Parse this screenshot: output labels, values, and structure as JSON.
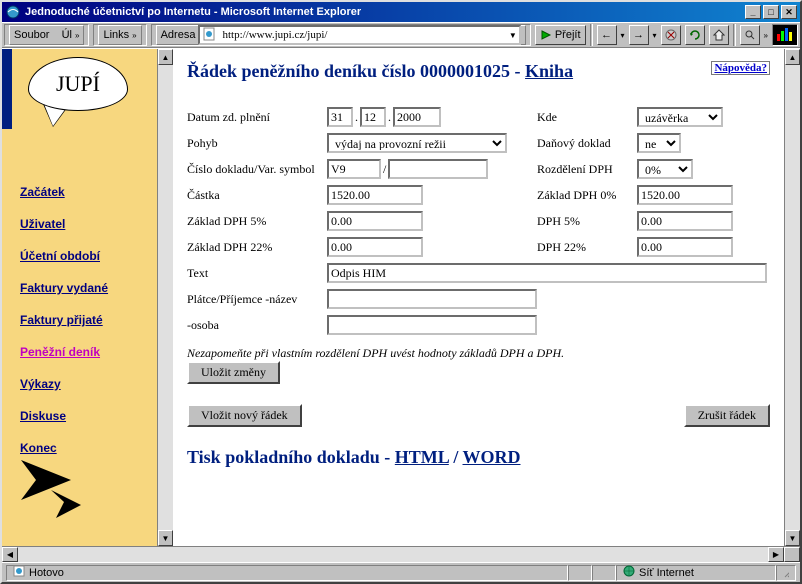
{
  "window": {
    "title": "Jednoduché účetnictví po Internetu - Microsoft Internet Explorer"
  },
  "toolbar": {
    "menu_soubor": "Soubor",
    "menu_uj": "Úl",
    "links_label": "Links",
    "adresa_label": "Adresa",
    "url": "http://www.jupi.cz/jupi/",
    "go_label": "Přejít"
  },
  "sidebar": {
    "logo_text": "JUPÍ",
    "items": [
      {
        "label": "Začátek"
      },
      {
        "label": "Uživatel"
      },
      {
        "label": "Účetní období"
      },
      {
        "label": "Faktury vydané"
      },
      {
        "label": "Faktury přijaté"
      },
      {
        "label": "Peněžní deník"
      },
      {
        "label": "Výkazy"
      },
      {
        "label": "Diskuse"
      },
      {
        "label": "Konec"
      }
    ]
  },
  "page": {
    "heading_pre": "Řádek peněžního deníku číslo 0000001025 - ",
    "heading_link": "Kniha",
    "help": "Nápověda?"
  },
  "form": {
    "labels": {
      "datum": "Datum zd. plnění",
      "pohyb": "Pohyb",
      "cislo": "Číslo dokladu/Var. symbol",
      "castka": "Částka",
      "zaklad5": "Základ DPH 5%",
      "zaklad22": "Základ DPH 22%",
      "text": "Text",
      "platce": "Plátce/Příjemce -název",
      "osoba": "-osoba",
      "kde": "Kde",
      "dandoklad": "Daňový doklad",
      "rozdeleni": "Rozdělení DPH",
      "zaklad0": "Základ DPH 0%",
      "dph5": "DPH 5%",
      "dph22": "DPH 22%"
    },
    "values": {
      "den": "31",
      "mesic": "12",
      "rok": "2000",
      "pohyb": "výdaj na provozní režii",
      "doklad": "V9",
      "varsym": "",
      "kde": "uzávěrka",
      "dandoklad": "ne",
      "rozdeleni": "0%",
      "castka": "1520.00",
      "zaklad0": "1520.00",
      "zaklad5": "0.00",
      "dph5": "0.00",
      "zaklad22": "0.00",
      "dph22": "0.00",
      "text": "Odpis HIM",
      "platce": "",
      "osoba": ""
    },
    "note": "Nezapomeňte při vlastním rozdělení DPH uvést hodnoty základů DPH a DPH.",
    "btn_save": "Uložit změny",
    "btn_new": "Vložit nový řádek",
    "btn_cancel": "Zrušit řádek"
  },
  "print": {
    "heading": "Tisk pokladního dokladu - ",
    "html": "HTML",
    "sep": " / ",
    "word": "WORD"
  },
  "status": {
    "left": "Hotovo",
    "right": "Síť Internet"
  }
}
